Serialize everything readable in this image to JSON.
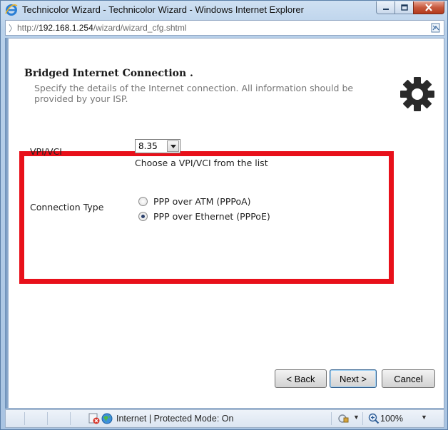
{
  "window": {
    "title": "Technicolor Wizard - Technicolor Wizard - Windows Internet Explorer",
    "address_prefix": "http://",
    "address_host": "192.168.1.254",
    "address_path": "/wizard/wizard_cfg.shtml"
  },
  "wizard": {
    "heading": "Bridged Internet Connection .",
    "description": "Specify the details of the Internet connection. All information should be provided by your ISP.",
    "vpi_label": "VPI/VCI",
    "vpi_selected": "8.35",
    "vpi_hint": "Choose a VPI/VCI from the list",
    "conn_type_label": "Connection Type",
    "options": [
      {
        "label": "PPP over ATM (PPPoA)",
        "checked": false
      },
      {
        "label": "PPP over Ethernet (PPPoE)",
        "checked": true
      }
    ]
  },
  "buttons": {
    "back": "< Back",
    "next": "Next >",
    "cancel": "Cancel"
  },
  "statusbar": {
    "zone": "Internet | Protected Mode: On",
    "zoom": "100%"
  },
  "colors": {
    "highlight": "#e8101a"
  }
}
